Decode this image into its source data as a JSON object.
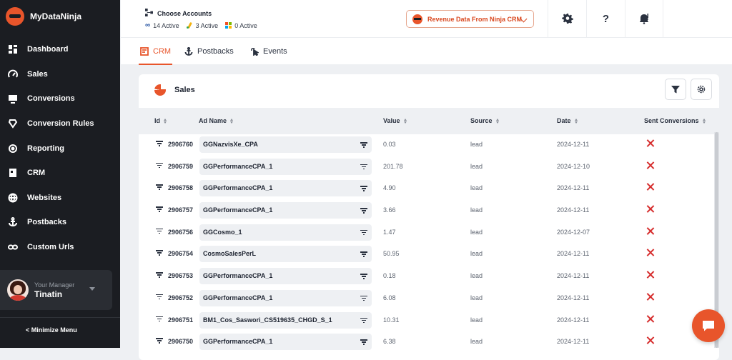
{
  "app": {
    "name": "MyDataNinja"
  },
  "sidebar": {
    "items": [
      {
        "label": "Dashboard",
        "icon": "dashboard-icon"
      },
      {
        "label": "Sales",
        "icon": "gauge-icon"
      },
      {
        "label": "Conversions",
        "icon": "monitor-icon"
      },
      {
        "label": "Conversion Rules",
        "icon": "rules-icon"
      },
      {
        "label": "Reporting",
        "icon": "reporting-icon"
      },
      {
        "label": "CRM",
        "icon": "crm-icon"
      },
      {
        "label": "Websites",
        "icon": "globe-icon"
      },
      {
        "label": "Postbacks",
        "icon": "anchor-icon"
      },
      {
        "label": "Custom Urls",
        "icon": "link-icon"
      }
    ],
    "manager_label": "Your Manager",
    "manager_name": "Tinatin",
    "minimize": "< Minimize Menu"
  },
  "header": {
    "choose_accounts": "Choose Accounts",
    "accounts": [
      {
        "label": "14 Active",
        "icon": "meta-icon"
      },
      {
        "label": "3 Active",
        "icon": "google-ads-icon"
      },
      {
        "label": "0 Active",
        "icon": "microsoft-icon"
      }
    ],
    "revenue_button": "Revenue Data From Ninja CRM",
    "help": "?"
  },
  "tabs": [
    {
      "label": "CRM",
      "active": true
    },
    {
      "label": "Postbacks",
      "active": false
    },
    {
      "label": "Events",
      "active": false
    }
  ],
  "panel": {
    "title": "Sales"
  },
  "table": {
    "columns": [
      "Id",
      "Ad Name",
      "Value",
      "Source",
      "Date",
      "Sent Conversions"
    ],
    "rows": [
      {
        "id": "2906760",
        "ad_name": "GGNazvisXe_CPA",
        "value": "0.03",
        "source": "lead",
        "date": "2024-12-11"
      },
      {
        "id": "2906759",
        "ad_name": "GGPerformanceCPA_1",
        "value": "201.78",
        "source": "lead",
        "date": "2024-12-10"
      },
      {
        "id": "2906758",
        "ad_name": "GGPerformanceCPA_1",
        "value": "4.90",
        "source": "lead",
        "date": "2024-12-11"
      },
      {
        "id": "2906757",
        "ad_name": "GGPerformanceCPA_1",
        "value": "3.66",
        "source": "lead",
        "date": "2024-12-11"
      },
      {
        "id": "2906756",
        "ad_name": "GGCosmo_1",
        "value": "1.47",
        "source": "lead",
        "date": "2024-12-07"
      },
      {
        "id": "2906754",
        "ad_name": "CosmoSalesPerL",
        "value": "50.95",
        "source": "lead",
        "date": "2024-12-11"
      },
      {
        "id": "2906753",
        "ad_name": "GGPerformanceCPA_1",
        "value": "0.18",
        "source": "lead",
        "date": "2024-12-11"
      },
      {
        "id": "2906752",
        "ad_name": "GGPerformanceCPA_1",
        "value": "6.08",
        "source": "lead",
        "date": "2024-12-11"
      },
      {
        "id": "2906751",
        "ad_name": "BM1_Cos_Saswori_CS519635_CHGD_S_1",
        "value": "10.31",
        "source": "lead",
        "date": "2024-12-11"
      },
      {
        "id": "2906750",
        "ad_name": "GGPerformanceCPA_1",
        "value": "6.38",
        "source": "lead",
        "date": "2024-12-11"
      }
    ]
  },
  "colors": {
    "accent": "#e8552b",
    "sidebar_bg": "#1b1d22",
    "error": "#d62d2d"
  }
}
